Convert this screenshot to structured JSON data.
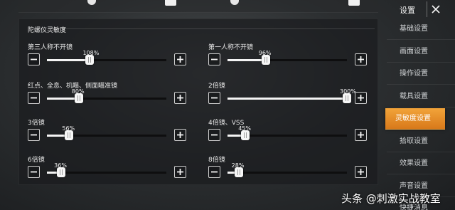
{
  "section": {
    "title": "陀螺仪灵敏度"
  },
  "settings": [
    {
      "name": "第三人称不开镜",
      "value_label": "108%",
      "value": 108,
      "max": 300
    },
    {
      "name": "第一人称不开镜",
      "value_label": "96%",
      "value": 96,
      "max": 300
    },
    {
      "name": "红点、全息、机瞄、侧面瞄准镜",
      "value_label": "80%",
      "value": 80,
      "max": 300
    },
    {
      "name": "2倍镜",
      "value_label": "300%",
      "value": 300,
      "max": 300
    },
    {
      "name": "3倍镜",
      "value_label": "56%",
      "value": 56,
      "max": 300
    },
    {
      "name": "4倍镜、VSS",
      "value_label": "45%",
      "value": 45,
      "max": 300
    },
    {
      "name": "6倍镜",
      "value_label": "36%",
      "value": 36,
      "max": 300
    },
    {
      "name": "8倍镜",
      "value_label": "28%",
      "value": 28,
      "max": 300
    }
  ],
  "menu": {
    "title": "设置",
    "items": [
      {
        "label": "基础设置"
      },
      {
        "label": "画面设置"
      },
      {
        "label": "操作设置"
      },
      {
        "label": "载具设置"
      },
      {
        "label": "灵敏度设置",
        "active": true
      },
      {
        "label": "拾取设置"
      },
      {
        "label": "效果设置"
      },
      {
        "label": "声音设置"
      },
      {
        "label": "快捷消息"
      }
    ]
  },
  "watermark": {
    "text": "头条 @刺激实战教室"
  },
  "colors": {
    "accent": "#f2a43a",
    "panel": "#1a1c1e",
    "text": "#e8e8e8"
  },
  "icons": {
    "minus": "minus-icon",
    "plus": "plus-icon",
    "close": "close-icon"
  }
}
